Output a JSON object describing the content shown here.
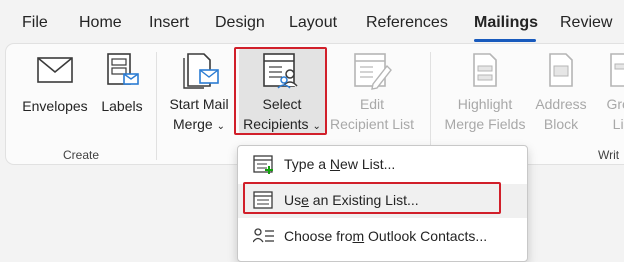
{
  "tabs": {
    "file": "File",
    "home": "Home",
    "insert": "Insert",
    "design": "Design",
    "layout": "Layout",
    "references": "References",
    "mailings": "Mailings",
    "review": "Review",
    "active": "Mailings"
  },
  "ribbon": {
    "create": {
      "envelopes": "Envelopes",
      "labels": "Labels",
      "group_label": "Create"
    },
    "start": {
      "start_mail_merge_line1": "Start Mail",
      "start_mail_merge_line2": "Merge",
      "select_recipients_line1": "Select",
      "select_recipients_line2": "Recipients",
      "edit_recipient_list_line1": "Edit",
      "edit_recipient_list_line2": "Recipient List"
    },
    "write": {
      "highlight_line1": "Highlight",
      "highlight_line2": "Merge Fields",
      "address_line1": "Address",
      "address_line2": "Block",
      "greeting_line1": "Gree",
      "greeting_line2": "Lin",
      "group_label": "Writ"
    }
  },
  "menu": {
    "items": [
      {
        "pre": "Type a ",
        "accel": "N",
        "post": "ew List..."
      },
      {
        "pre": "Us",
        "accel": "e",
        "post": " an Existing List...",
        "selected": true
      },
      {
        "pre": "Choose fro",
        "accel": "m",
        "post": " Outlook Contacts..."
      }
    ]
  },
  "colors": {
    "highlight_border": "#d11f2a",
    "accent": "#185abd",
    "icon_blue": "#2b7cd3",
    "disabled_text": "#a8a8a8"
  },
  "icons": {
    "envelopes": "envelope-icon",
    "labels": "labels-icon",
    "start_mail_merge": "mail-merge-icon",
    "select_recipients": "recipients-icon",
    "edit_recipient_list": "edit-list-icon",
    "highlight_merge_fields": "highlight-fields-icon",
    "address_block": "address-block-icon",
    "greeting_line": "greeting-line-icon",
    "new_list": "new-list-icon",
    "existing_list": "existing-list-icon",
    "outlook_contacts": "contacts-icon",
    "dropdown_chevron": "chevron-down-icon"
  }
}
